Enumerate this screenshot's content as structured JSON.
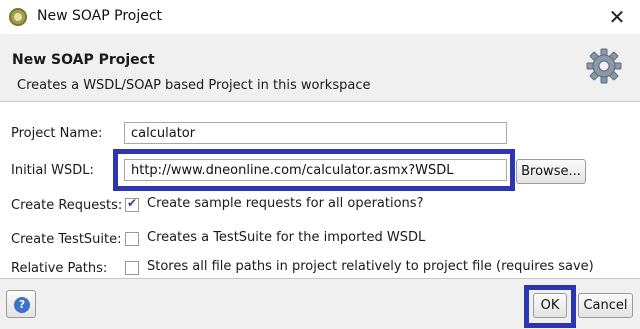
{
  "window": {
    "title": "New SOAP Project"
  },
  "header": {
    "title": "New SOAP Project",
    "description": "Creates a WSDL/SOAP based Project in this workspace",
    "icon": "gear-icon"
  },
  "form": {
    "project_name_label": "Project Name:",
    "project_name_value": "calculator",
    "initial_wsdl_label": "Initial WSDL:",
    "initial_wsdl_value": "http://www.dneonline.com/calculator.asmx?WSDL",
    "browse_label": "Browse...",
    "create_requests": {
      "label": "Create Requests:",
      "text": "Create sample requests for all operations?",
      "checked": true
    },
    "create_testsuite": {
      "label": "Create TestSuite:",
      "text": "Creates a TestSuite for the imported WSDL",
      "checked": false
    },
    "relative_paths": {
      "label": "Relative Paths:",
      "text": "Stores all file paths in project relatively to project file (requires save)",
      "checked": false
    }
  },
  "footer": {
    "help_icon": "help-icon",
    "ok_label": "OK",
    "cancel_label": "Cancel"
  },
  "colors": {
    "highlight": "#2e35b3",
    "banner": "#f0f0f0"
  }
}
